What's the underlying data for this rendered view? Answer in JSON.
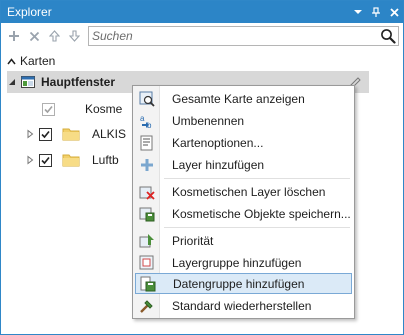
{
  "panel": {
    "title": "Explorer",
    "controls": [
      "chevron-down-icon",
      "pin-icon",
      "close-icon"
    ]
  },
  "toolbar": {
    "tools": [
      "add-icon",
      "delete-icon",
      "arrow-up-icon",
      "arrow-down-icon"
    ],
    "search_placeholder": "Suchen"
  },
  "tree": {
    "section_label": "Karten",
    "map": {
      "label": "Hauptfenster"
    },
    "layers": [
      {
        "label": "Kosmetisch",
        "visible_text": "Kosme",
        "checked": true,
        "dim": true,
        "folder": false
      },
      {
        "label": "ALKIS",
        "visible_text": "ALKIS",
        "checked": true,
        "dim": false,
        "folder": true
      },
      {
        "label": "Luftbild",
        "visible_text": "Luftb",
        "checked": true,
        "dim": false,
        "folder": true
      }
    ]
  },
  "context_menu": {
    "items": [
      {
        "label": "Gesamte Karte anzeigen",
        "icon": "zoom-extent-icon"
      },
      {
        "label": "Umbenennen",
        "icon": "rename-icon"
      },
      {
        "label": "Kartenoptionen...",
        "icon": "map-options-icon"
      },
      {
        "label": "Layer hinzufügen",
        "icon": "add-layer-icon"
      },
      {
        "label": "Kosmetischen Layer löschen",
        "icon": "delete-cosmetic-layer-icon"
      },
      {
        "label": "Kosmetische Objekte speichern...",
        "icon": "save-cosmetic-objects-icon"
      },
      {
        "label": "Priorität",
        "icon": "priority-icon"
      },
      {
        "label": "Layergruppe hinzufügen",
        "icon": "add-layer-group-icon"
      },
      {
        "label": "Datengruppe hinzufügen",
        "icon": "add-data-group-icon",
        "hovered": true
      },
      {
        "label": "Standard wiederherstellen",
        "icon": "restore-default-icon"
      }
    ]
  },
  "colors": {
    "titlebar": "#2c85c7",
    "selection": "#d8d8d8",
    "menu_hover": "#dbeaf7",
    "menu_hover_border": "#7aa9d6"
  }
}
